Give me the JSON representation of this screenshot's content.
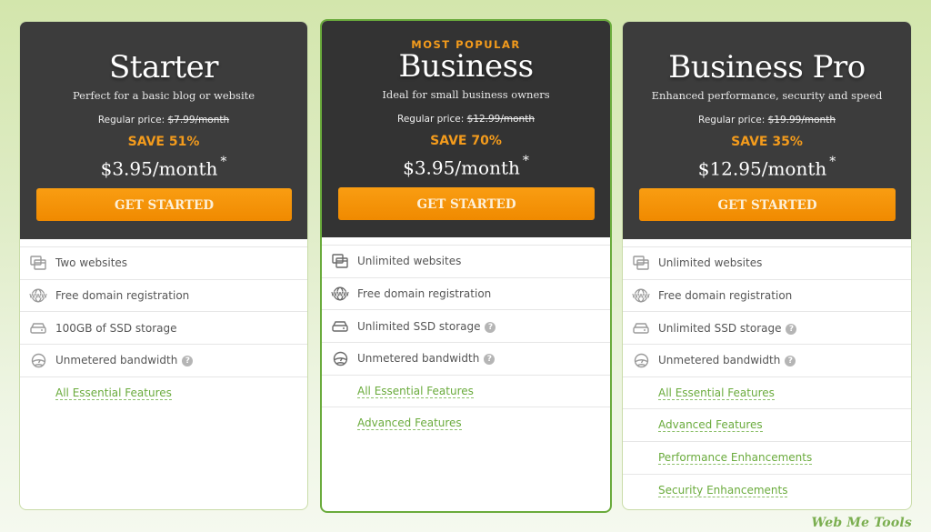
{
  "plans": [
    {
      "badge": "",
      "name": "Starter",
      "tagline": "Perfect for a basic blog or website",
      "regular_label": "Regular price:",
      "regular_price": "$7.99/month",
      "save": "SAVE 51%",
      "price": "$3.95/month",
      "price_note": "*",
      "cta": "GET STARTED",
      "featured": false,
      "features": [
        {
          "icon": "websites-icon",
          "text": "Two websites",
          "help": false
        },
        {
          "icon": "www-globe-icon",
          "text": "Free domain registration",
          "help": false
        },
        {
          "icon": "ssd-drive-icon",
          "text": "100GB of SSD storage",
          "help": false
        },
        {
          "icon": "speedometer-icon",
          "text": "Unmetered bandwidth",
          "help": true
        }
      ],
      "links": [
        "All Essential Features"
      ]
    },
    {
      "badge": "MOST POPULAR",
      "name": "Business",
      "tagline": "Ideal for small business owners",
      "regular_label": "Regular price:",
      "regular_price": "$12.99/month",
      "save": "SAVE 70%",
      "price": "$3.95/month",
      "price_note": "*",
      "cta": "GET STARTED",
      "featured": true,
      "features": [
        {
          "icon": "websites-icon",
          "text": "Unlimited websites",
          "help": false
        },
        {
          "icon": "www-globe-icon",
          "text": "Free domain registration",
          "help": false
        },
        {
          "icon": "ssd-drive-icon",
          "text": "Unlimited SSD storage",
          "help": true
        },
        {
          "icon": "speedometer-icon",
          "text": "Unmetered bandwidth",
          "help": true
        }
      ],
      "links": [
        "All Essential Features",
        "Advanced Features"
      ]
    },
    {
      "badge": "",
      "name": "Business Pro",
      "tagline": "Enhanced performance, security and speed",
      "regular_label": "Regular price:",
      "regular_price": "$19.99/month",
      "save": "SAVE 35%",
      "price": "$12.95/month",
      "price_note": "*",
      "cta": "GET STARTED",
      "featured": false,
      "features": [
        {
          "icon": "websites-icon",
          "text": "Unlimited websites",
          "help": false
        },
        {
          "icon": "www-globe-icon",
          "text": "Free domain registration",
          "help": false
        },
        {
          "icon": "ssd-drive-icon",
          "text": "Unlimited SSD storage",
          "help": true
        },
        {
          "icon": "speedometer-icon",
          "text": "Unmetered bandwidth",
          "help": true
        }
      ],
      "links": [
        "All Essential Features",
        "Advanced Features",
        "Performance Enhancements",
        "Security Enhancements"
      ]
    }
  ],
  "help_glyph": "?",
  "watermark": "Web Me Tools",
  "colors": {
    "accent_orange": "#f39b1c",
    "button_orange": "#f59300",
    "link_green": "#6aab3c",
    "header_dark": "#3c3c3c",
    "featured_border": "#6aab3c"
  }
}
